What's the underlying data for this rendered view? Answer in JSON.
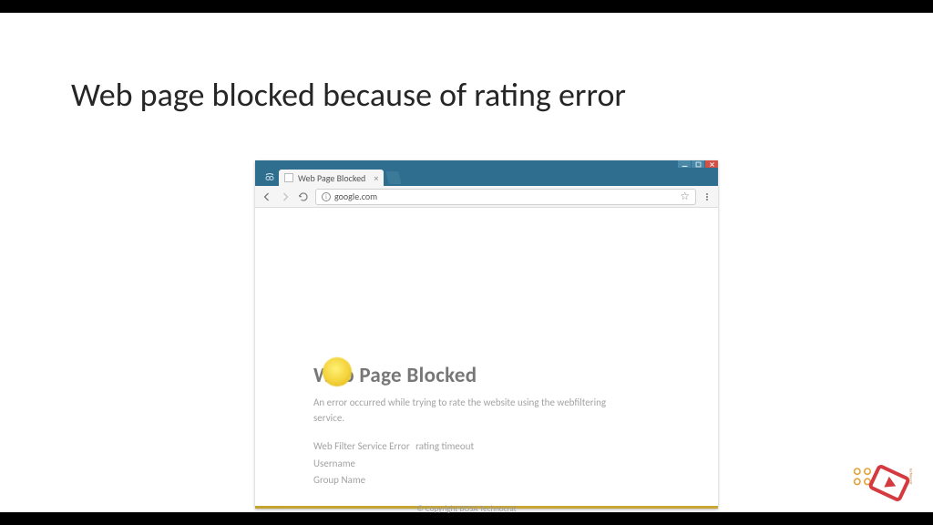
{
  "slide": {
    "title": "Web page blocked because of rating error",
    "footer": "© Copyright BOSA Technocrat"
  },
  "browser": {
    "tab_title": "Web Page Blocked",
    "url": "google.com"
  },
  "blocked": {
    "heading": "Web Page Blocked",
    "message": "An error occurred while trying to rate the website using the webfiltering service.",
    "rows": [
      {
        "label": "Web Filter Service Error",
        "value": "rating timeout"
      },
      {
        "label": "Username",
        "value": ""
      },
      {
        "label": "Group Name",
        "value": ""
      }
    ]
  }
}
